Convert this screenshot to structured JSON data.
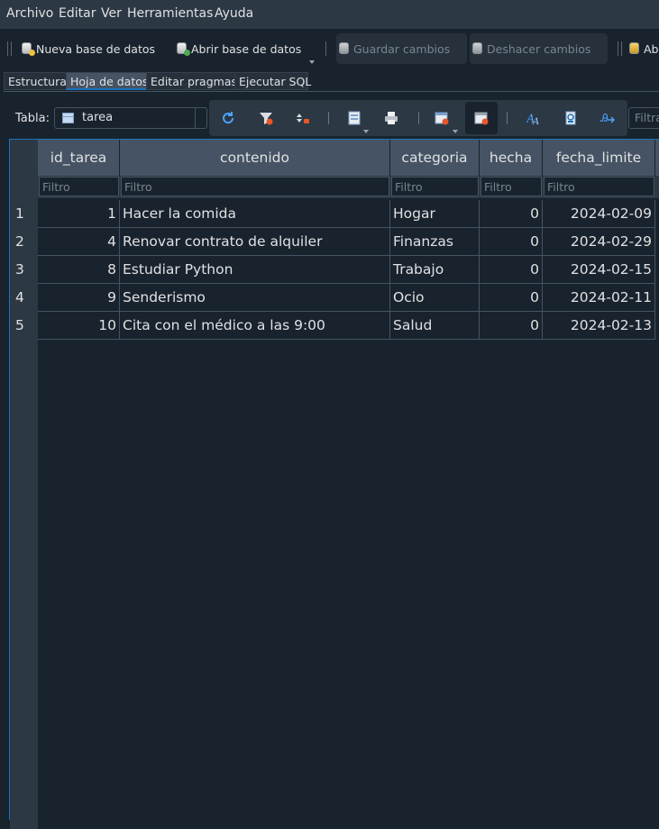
{
  "menu": [
    "Archivo",
    "Editar",
    "Ver",
    "Herramientas",
    "Ayuda"
  ],
  "toolbar": {
    "new_db": "Nueva base de datos",
    "open_db": "Abrir base de datos",
    "save": "Guardar cambios",
    "undo": "Deshacer cambios",
    "more": "Ab"
  },
  "tabs": [
    "Estructura",
    "Hoja de datos",
    "Editar pragmas",
    "Ejecutar SQL"
  ],
  "active_tab": "Hoja de datos",
  "table_selector": {
    "label": "Tabla:",
    "value": "tarea"
  },
  "filter_search_placeholder": "Filtra",
  "grid": {
    "columns": [
      "id_tarea",
      "contenido",
      "categoria",
      "hecha",
      "fecha_limite"
    ],
    "filter_placeholder": "Filtro",
    "rows": [
      {
        "n": "1",
        "cells": [
          "1",
          "Hacer la comida",
          "Hogar",
          "0",
          "2024-02-09"
        ]
      },
      {
        "n": "2",
        "cells": [
          "4",
          "Renovar contrato de alquiler",
          "Finanzas",
          "0",
          "2024-02-29"
        ]
      },
      {
        "n": "3",
        "cells": [
          "8",
          "Estudiar Python",
          "Trabajo",
          "0",
          "2024-02-15"
        ]
      },
      {
        "n": "4",
        "cells": [
          "9",
          "Senderismo",
          "Ocio",
          "0",
          "2024-02-11"
        ]
      },
      {
        "n": "5",
        "cells": [
          "10",
          "Cita con el médico a las 9:00",
          "Salud",
          "0",
          "2024-02-13"
        ]
      }
    ]
  },
  "tool_icons": [
    "refresh-icon",
    "clear-filters-icon",
    "sort-icon",
    "new-record-icon",
    "print-icon",
    "insert-record-icon",
    "delete-record-icon",
    "find-icon",
    "find-replace-icon",
    "goto-icon"
  ],
  "colors": {
    "accent": "#1a72bb",
    "background": "#19232d",
    "header": "#455364"
  }
}
